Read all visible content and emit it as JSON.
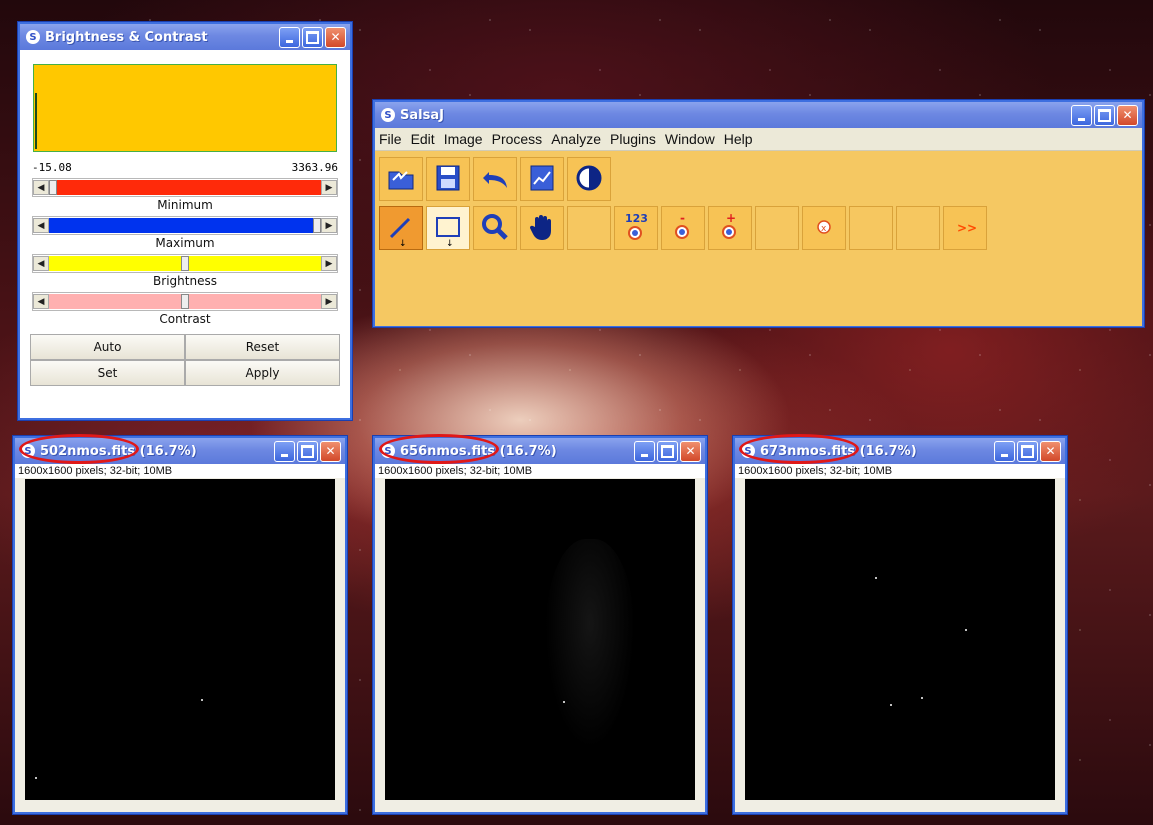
{
  "brightness_contrast": {
    "title": "Brightness & Contrast",
    "range_min": "-15.08",
    "range_max": "3363.96",
    "sliders": [
      {
        "label": "Minimum",
        "color": "#ff2a0a",
        "level": 0.0
      },
      {
        "label": "Maximum",
        "color": "#0033ee",
        "level": 1.0
      },
      {
        "label": "Brightness",
        "color": "#ffff00",
        "level": 0.5
      },
      {
        "label": "Contrast",
        "color": "#ffb0b0",
        "level": 0.5
      }
    ],
    "buttons": {
      "auto": "Auto",
      "reset": "Reset",
      "set": "Set",
      "apply": "Apply"
    },
    "histogram_color": "#ffc800"
  },
  "salsaj": {
    "title": "SalsaJ",
    "menu": [
      "File",
      "Edit",
      "Image",
      "Process",
      "Analyze",
      "Plugins",
      "Window",
      "Help"
    ],
    "toolbar_row1": [
      "open-icon",
      "save-icon",
      "undo-icon",
      "plot-icon",
      "contrast-icon"
    ],
    "toolbar_row2": [
      "line-tool-icon",
      "rectangle-tool-icon",
      "magnifier-icon",
      "hand-icon",
      "",
      "count-target-icon",
      "minus-target-icon",
      "plus-target-icon",
      "",
      "delete-target-icon",
      "",
      "",
      "more-icon"
    ],
    "count_label": "123",
    "minus_label": "-",
    "plus_label": "+",
    "more_label": ">>",
    "delete_label": "x"
  },
  "image_windows": [
    {
      "title": "502nmos.fits (16.7%)",
      "info": "1600x1600 pixels; 32-bit; 10MB"
    },
    {
      "title": "656nmos.fits (16.7%)",
      "info": "1600x1600 pixels; 32-bit; 10MB"
    },
    {
      "title": "673nmos.fits (16.7%)",
      "info": "1600x1600 pixels; 32-bit; 10MB"
    }
  ],
  "window_buttons": {
    "minimize": "_",
    "maximize": "□",
    "close": "✕"
  },
  "app_icon": "S"
}
